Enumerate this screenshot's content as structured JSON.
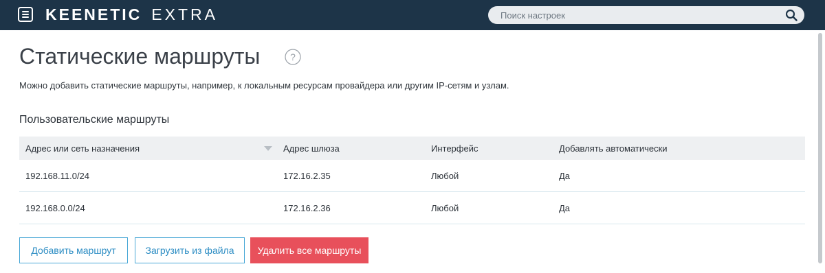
{
  "header": {
    "brand_main": "KEENETIC",
    "brand_sub": "EXTRA",
    "menu_icon": "menu-icon",
    "search": {
      "placeholder": "Поиск настроек",
      "value": "",
      "icon": "search-icon"
    }
  },
  "page": {
    "title": "Статические маршруты",
    "help_icon": "help-icon",
    "description": "Можно добавить статические маршруты, например, к локальным ресурсам провайдера или другим IP-сетям и узлам."
  },
  "routes": {
    "section_title": "Пользовательские маршруты",
    "columns": [
      "Адрес или сеть назначения",
      "Адрес шлюза",
      "Интерфейс",
      "Добавлять автоматически"
    ],
    "rows": [
      [
        "192.168.11.0/24",
        "172.16.2.35",
        "Любой",
        "Да"
      ],
      [
        "192.168.0.0/24",
        "172.16.2.36",
        "Любой",
        "Да"
      ]
    ]
  },
  "actions": {
    "add_label": "Добавить маршрут",
    "load_label": "Загрузить из файла",
    "delete_all_label": "Удалить все маршруты"
  },
  "colors": {
    "header_bg": "#1d3448",
    "accent": "#47a7d6",
    "danger": "#e8505b"
  }
}
